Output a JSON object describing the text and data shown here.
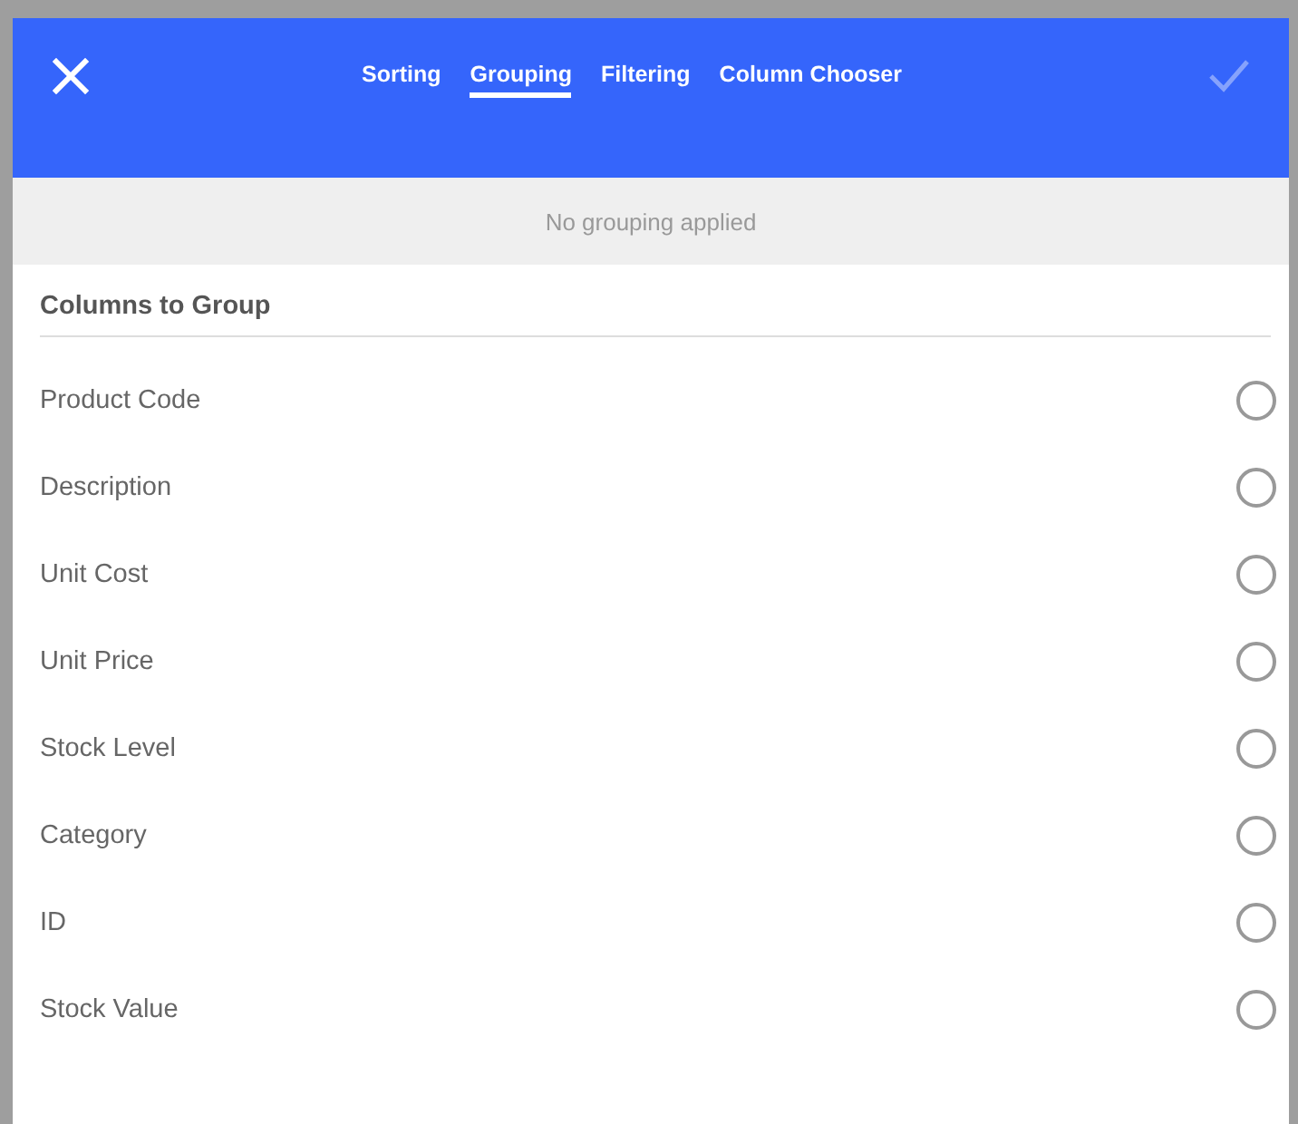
{
  "header": {
    "confirm": {
      "disabled": true
    },
    "tabs": [
      {
        "label": "Sorting",
        "selected": false
      },
      {
        "label": "Grouping",
        "selected": true
      },
      {
        "label": "Filtering",
        "selected": false
      },
      {
        "label": "Column Chooser",
        "selected": false
      }
    ]
  },
  "status": "No grouping applied",
  "section": {
    "title": "Columns to Group",
    "items": [
      {
        "label": "Product Code",
        "selected": false
      },
      {
        "label": "Description",
        "selected": false
      },
      {
        "label": "Unit Cost",
        "selected": false
      },
      {
        "label": "Unit Price",
        "selected": false
      },
      {
        "label": "Stock Level",
        "selected": false
      },
      {
        "label": "Category",
        "selected": false
      },
      {
        "label": "ID",
        "selected": false
      },
      {
        "label": "Stock Value",
        "selected": false
      }
    ]
  }
}
